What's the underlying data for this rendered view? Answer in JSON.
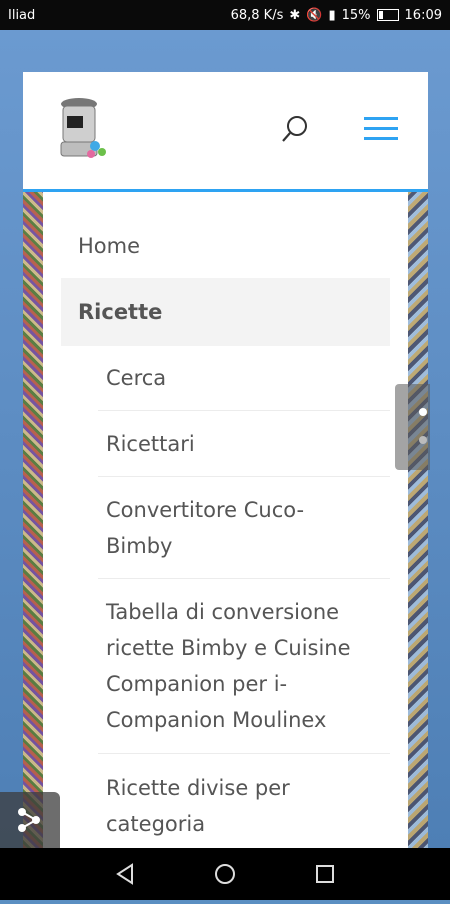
{
  "status_bar": {
    "carrier": "Iliad",
    "speed": "68,8 K/s",
    "battery": "15%",
    "time": "16:09"
  },
  "menu": {
    "home": "Home",
    "recipes": "Ricette",
    "sub_items": [
      "Cerca",
      "Ricettari",
      "Convertitore Cuco-Bimby",
      "Tabella di conversione ricette Bimby e Cuisine Companion per i-Companion Moulinex",
      "Ricette divise per categoria"
    ]
  },
  "colors": {
    "accent": "#2ea3f2",
    "background": "#5b8fc2",
    "text": "#555555"
  }
}
